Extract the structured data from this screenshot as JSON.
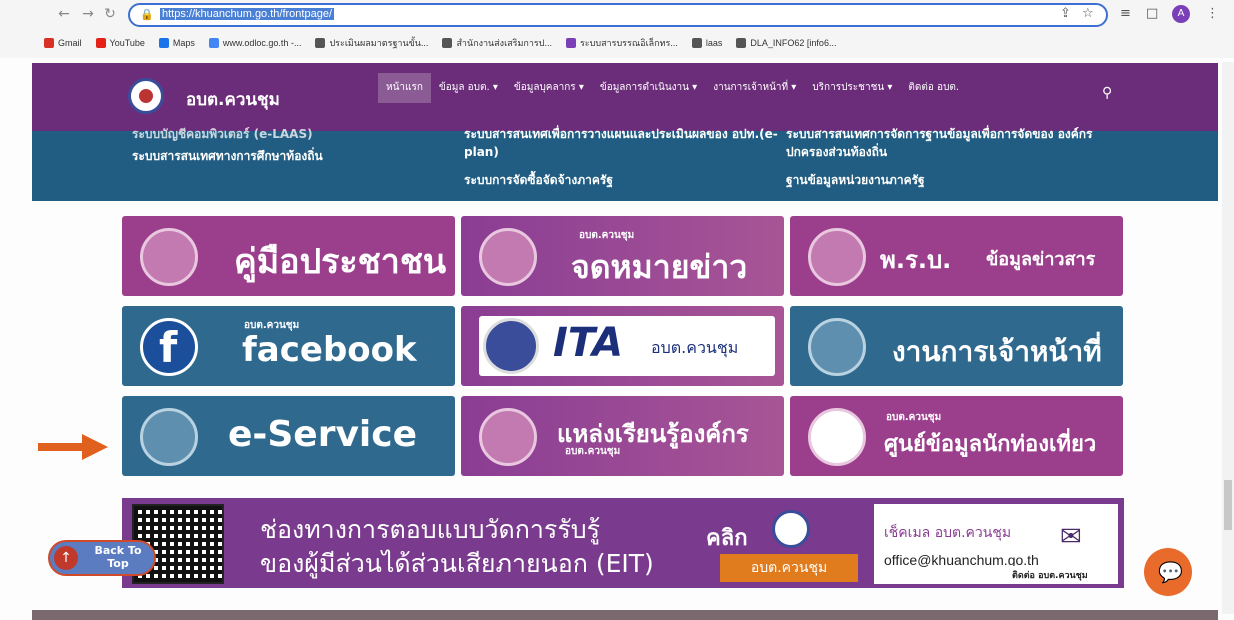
{
  "browser": {
    "url": "https://khuanchum.go.th/frontpage/",
    "profile_initial": "A",
    "bookmarks": [
      {
        "label": "Gmail",
        "color": "#d93025"
      },
      {
        "label": "YouTube",
        "color": "#e62117"
      },
      {
        "label": "Maps",
        "color": "#1a73e8"
      },
      {
        "label": "www.odloc.go.th -...",
        "color": "#4285f4"
      },
      {
        "label": "ประเมินผลมาตรฐานขั้น...",
        "color": "#555555"
      },
      {
        "label": "สำนักงานส่งเสริมการป...",
        "color": "#555555"
      },
      {
        "label": "ระบบสารบรรณอิเล็กทร...",
        "color": "#7b3fb7"
      },
      {
        "label": "laas",
        "color": "#555555"
      },
      {
        "label": "DLA_INFO62 [info6...",
        "color": "#555555"
      }
    ]
  },
  "header": {
    "site_name": "อบต.ควนชุม",
    "nav": [
      "หน้าแรก",
      "ข้อมูล อบต. ▾",
      "ข้อมูลบุคลากร ▾",
      "ข้อมูลการดำเนินงาน ▾",
      "งานการเจ้าหน้าที่ ▾",
      "บริการประชาชน ▾",
      "ติดต่อ อบต."
    ]
  },
  "submenu": {
    "items": [
      "ระบบบัญชีคอมพิวเตอร์ (e-LAAS)",
      "ระบบสารสนเทศทางการศึกษาท้องถิ่น",
      "ระบบสารสนเทศเพื่อการวางแผนและประเมินผลของ อปท.(e-plan)",
      "ระบบการจัดซื้อจัดจ้างภาครัฐ",
      "ระบบสารสนเทศการจัดการฐานข้อมูลเพื่อการจัดของ องค์กรปกครองส่วนท้องถิ่น",
      "ฐานข้อมูลหน่วยงานภาครัฐ"
    ]
  },
  "tiles": {
    "manual": {
      "big": "คู่มือประชาชน"
    },
    "news": {
      "small": "อบต.ควนชุม",
      "big": "จดหมายข่าว"
    },
    "info_act": {
      "big": "พ.ร.บ.",
      "sub": "ข้อมูลข่าวสาร"
    },
    "facebook": {
      "small": "อบต.ควนชุม",
      "big": "facebook"
    },
    "ita": {
      "big": "ITA",
      "sub": "อบต.ควนชุม"
    },
    "personnel": {
      "big": "งานการเจ้าหน้าที่"
    },
    "eservice": {
      "big": "e-Service"
    },
    "learning": {
      "big": "แหล่งเรียนรู้องค์กร",
      "small": "อบต.ควนชุม"
    },
    "tourism": {
      "small": "อบต.ควนชุม",
      "big": "ศูนย์ข้อมูลนักท่องเที่ยว"
    }
  },
  "eit": {
    "line1": "ช่องทางการตอบแบบวัดการรับรู้",
    "line2": "ของผู้มีส่วนได้ส่วนเสียภายนอก (EIT)",
    "click": "คลิก",
    "click_sub": "อบต.ควนชุม",
    "mail_title": "เช็คเมล อบต.ควนชุม",
    "mail_addr": "office@khuanchum.go.th"
  },
  "floating": {
    "back_to_top": "Back To Top",
    "contact": "ติดต่อ อบต.ควนชุม"
  }
}
